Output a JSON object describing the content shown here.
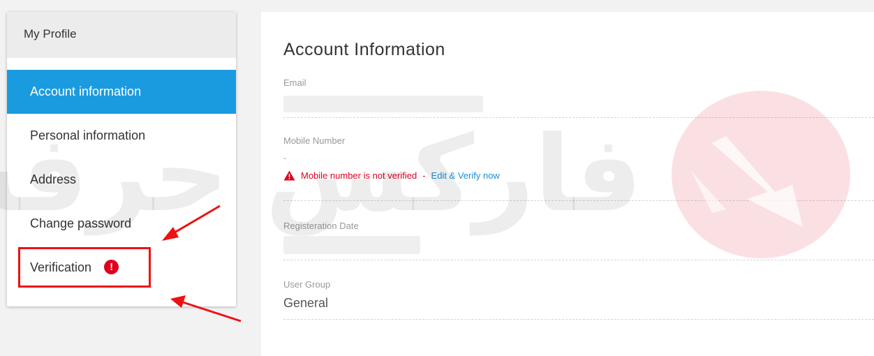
{
  "sidebar": {
    "header": "My Profile",
    "items": [
      {
        "label": "Account information",
        "active": true
      },
      {
        "label": "Personal information",
        "active": false
      },
      {
        "label": "Address",
        "active": false
      },
      {
        "label": "Change password",
        "active": false
      },
      {
        "label": "Verification",
        "active": false,
        "badge": "!"
      }
    ]
  },
  "main": {
    "title": "Account Information",
    "fields": {
      "email": {
        "label": "Email",
        "value": ""
      },
      "mobile": {
        "label": "Mobile Number",
        "value": "-",
        "warning": "Mobile number is not verified",
        "separator": "-",
        "verify_link": "Edit & Verify now"
      },
      "registration": {
        "label": "Registeration Date",
        "value": ""
      },
      "user_group": {
        "label": "User Group",
        "value": "General"
      }
    }
  },
  "watermark": {
    "text": "فارکس حرفه‌ای"
  },
  "colors": {
    "accent": "#1a9be0",
    "warning": "#e0001b",
    "link": "#1a8fd9",
    "annotation": "#e11111"
  },
  "icons": {
    "warning": "warning-triangle-icon",
    "verification_badge": "exclamation-circle-icon",
    "logo": "watermark-logo-icon"
  }
}
